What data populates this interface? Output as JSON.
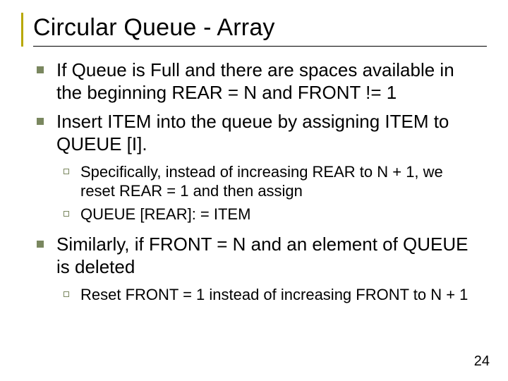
{
  "title": "Circular Queue - Array",
  "bullets": {
    "b1": "If Queue is Full and there are spaces available in the beginning REAR = N and FRONT != 1",
    "b2": "Insert ITEM into the queue by assigning ITEM to QUEUE [I].",
    "b2_sub": {
      "s1": "Specifically, instead of increasing REAR to N + 1, we reset REAR = 1 and then assign",
      "s2": "QUEUE [REAR]: = ITEM"
    },
    "b3": "Similarly, if FRONT = N and an element of QUEUE is deleted",
    "b3_sub": {
      "s1": "Reset FRONT = 1 instead of increasing FRONT to N + 1"
    }
  },
  "page_number": "24"
}
